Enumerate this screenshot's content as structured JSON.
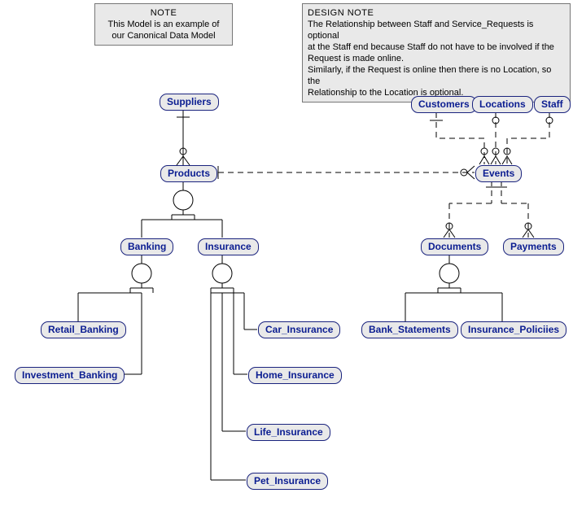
{
  "notes": {
    "left": {
      "title": "NOTE",
      "line1": "This Model is an example of",
      "line2": "our Canonical Data Model"
    },
    "right": {
      "title": "DESIGN NOTE",
      "line1": "The Relationship between Staff and Service_Requests is optional",
      "line2": "at the Staff end because Staff do not have to be involved if the",
      "line3": "Request is made online.",
      "line4": "Similarly, if the Request is online then there is no Location, so the",
      "line5": "Relationship to the Location is optional."
    }
  },
  "entities": {
    "suppliers": "Suppliers",
    "customers": "Customers",
    "locations": "Locations",
    "staff": "Staff",
    "products": "Products",
    "events": "Events",
    "banking": "Banking",
    "insurance": "Insurance",
    "documents": "Documents",
    "payments": "Payments",
    "retail_banking": "Retail_Banking",
    "investment_banking": "Investment_Banking",
    "car_insurance": "Car_Insurance",
    "home_insurance": "Home_Insurance",
    "life_insurance": "Life_Insurance",
    "pet_insurance": "Pet_Insurance",
    "bank_statements": "Bank_Statements",
    "insurance_policies": "Insurance_Policiies"
  }
}
